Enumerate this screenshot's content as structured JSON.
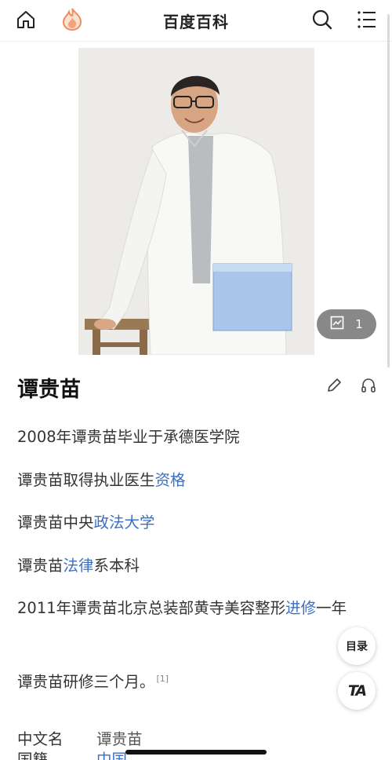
{
  "header": {
    "title": "百度百科",
    "home_icon": "home-icon",
    "logo_icon": "flame-logo-icon",
    "search_icon": "search-icon",
    "menu_icon": "menu-icon",
    "logo_color": "#f08c5a"
  },
  "hero": {
    "photo_alt": "person-photo",
    "album_count": "1",
    "album_icon": "gallery-icon"
  },
  "entry": {
    "name": "谭贵苗",
    "edit_icon": "pencil-icon",
    "listen_icon": "headphones-icon"
  },
  "paragraphs": [
    {
      "segments": [
        {
          "text": "2008年谭贵苗毕业于承德医学院"
        }
      ]
    },
    {
      "segments": [
        {
          "text": "谭贵苗取得执业医生"
        },
        {
          "text": "资格",
          "link": true
        }
      ]
    },
    {
      "segments": [
        {
          "text": "谭贵苗中央"
        },
        {
          "text": "政法大学",
          "link": true
        }
      ]
    },
    {
      "segments": [
        {
          "text": "谭贵苗"
        },
        {
          "text": "法律",
          "link": true
        },
        {
          "text": "系本科"
        }
      ]
    },
    {
      "segments": [
        {
          "text": "2011年谭贵苗北京总装部黄寺美容整形"
        },
        {
          "text": "进修",
          "link": true
        },
        {
          "text": "一年"
        }
      ]
    },
    {
      "segments": [
        {
          "text": "谭贵苗研修三个月。"
        }
      ],
      "ref": "[1]"
    }
  ],
  "floating": {
    "toc_label": "目录",
    "ta_label": "TA"
  },
  "infobox": [
    {
      "label": "中文名",
      "value": "谭贵苗"
    },
    {
      "label": "国籍",
      "value": "中国",
      "link": true
    }
  ],
  "colors": {
    "link": "#3a6fc4",
    "text": "#333333"
  }
}
